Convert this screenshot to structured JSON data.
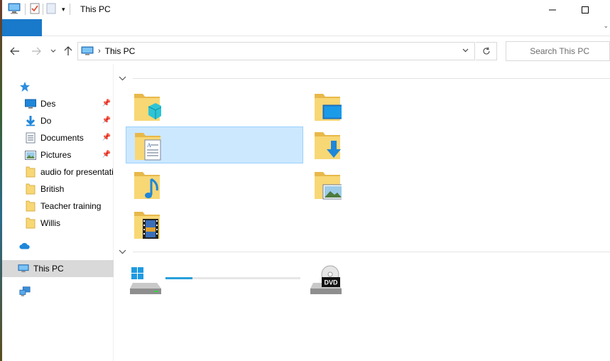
{
  "window": {
    "title": "This PC",
    "minimize_icon": "minimize-icon",
    "maximize_icon": "maximize-icon"
  },
  "address_bar": {
    "location": "This PC",
    "search_placeholder": "Search This PC"
  },
  "nav_pane": {
    "quick_access": [
      {
        "label": "Des",
        "icon": "desktop-icon",
        "pinned": true
      },
      {
        "label": "Do",
        "icon": "downloads-icon",
        "pinned": true
      },
      {
        "label": "Documents",
        "icon": "documents-icon",
        "pinned": true
      },
      {
        "label": "Pictures",
        "icon": "pictures-icon",
        "pinned": true
      },
      {
        "label": "audio for presentati",
        "icon": "folder-icon",
        "pinned": false
      },
      {
        "label": "British",
        "icon": "folder-icon",
        "pinned": false
      },
      {
        "label": "Teacher training",
        "icon": "folder-icon",
        "pinned": false
      },
      {
        "label": "Willis",
        "icon": "folder-icon",
        "pinned": false
      }
    ],
    "onedrive_icon": "onedrive-icon",
    "this_pc": "This PC",
    "network_icon": "network-icon"
  },
  "content": {
    "folders": [
      {
        "icon": "3d-objects-folder-icon"
      },
      {
        "icon": "desktop-folder-icon"
      },
      {
        "icon": "documents-folder-icon",
        "selected": true
      },
      {
        "icon": "downloads-folder-icon"
      },
      {
        "icon": "music-folder-icon"
      },
      {
        "icon": "pictures-folder-icon"
      },
      {
        "icon": "videos-folder-icon"
      }
    ],
    "drives": [
      {
        "icon": "windows-drive-icon",
        "usage_fraction": 0.2
      },
      {
        "icon": "dvd-drive-icon",
        "badge": "DVD"
      }
    ]
  },
  "colors": {
    "accent": "#1979ca",
    "selection": "#cce8ff",
    "folder": "#f8d775",
    "progress": "#26a0da"
  }
}
